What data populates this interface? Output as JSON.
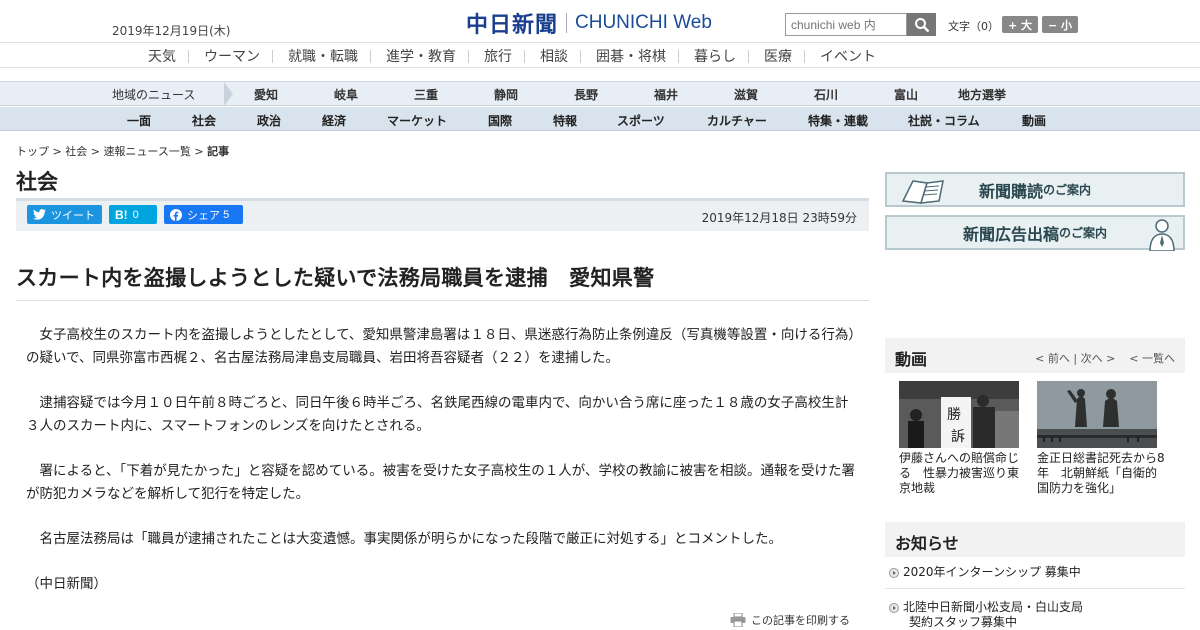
{
  "header": {
    "date": "2019年12月19日(木)",
    "logo_jp": "中日新聞",
    "logo_en": "CHUNICHI",
    "logo_web": "Web",
    "search_placeholder": "chunichi web 内",
    "font_label": "文字（0）",
    "font_up": "+ 大",
    "font_down": "− 小"
  },
  "nav_main": [
    "天気",
    "ウーマン",
    "就職・転職",
    "進学・教育",
    "旅行",
    "相談",
    "囲碁・将棋",
    "暮らし",
    "医療",
    "イベント"
  ],
  "nav_region": {
    "label": "地域のニュース",
    "items": [
      "愛知",
      "岐阜",
      "三重",
      "静岡",
      "長野",
      "福井",
      "滋賀",
      "石川",
      "富山",
      "地方選挙"
    ]
  },
  "nav_category": [
    "一面",
    "社会",
    "政治",
    "経済",
    "マーケット",
    "国際",
    "特報",
    "スポーツ",
    "カルチャー",
    "特集・連載",
    "社説・コラム",
    "動画"
  ],
  "breadcrumb": [
    "トップ",
    "社会",
    "速報ニュース一覧",
    "記事"
  ],
  "section_title": "社会",
  "share": {
    "tweet": "ツイート",
    "hatena": "B!",
    "hatena_count": "0",
    "facebook": "シェア",
    "facebook_count": "5"
  },
  "pubdate": "2019年12月18日 23時59分",
  "headline": "スカート内を盗撮しようとした疑いで法務局職員を逮捕　愛知県警",
  "paragraphs": [
    "　女子高校生のスカート内を盗撮しようとしたとして、愛知県警津島署は１８日、県迷惑行為防止条例違反（写真機等設置・向ける行為）の疑いで、同県弥富市西梶２、名古屋法務局津島支局職員、岩田将吾容疑者（２２）を逮捕した。",
    "　逮捕容疑では今月１０日午前８時ごろと、同日午後６時半ごろ、名鉄尾西線の電車内で、向かい合う席に座った１８歳の女子高校生計３人のスカート内に、スマートフォンのレンズを向けたとされる。",
    "　署によると、「下着が見たかった」と容疑を認めている。被害を受けた女子高校生の１人が、学校の教諭に被害を相談。通報を受けた署が防犯カメラなどを解析して犯行を特定した。",
    "　名古屋法務局は「職員が逮捕されたことは大変遺憾。事実関係が明らかになった段階で厳正に対処する」とコメントした。"
  ],
  "credit": "（中日新聞）",
  "print_label": "この記事を印刷する",
  "sidebar": {
    "banner1": {
      "big": "新聞購読",
      "small": "のご案内"
    },
    "banner2": {
      "big": "新聞広告出稿",
      "small": "のご案内"
    },
    "video": {
      "title": "動画",
      "prev": "前へ",
      "next": "次へ",
      "list": "一覧へ",
      "items": [
        {
          "caption": "伊藤さんへの賠償命じる　性暴力被害巡り東京地裁"
        },
        {
          "caption": "金正日総書記死去から8年　北朝鮮紙「自衛的国防力を強化」"
        }
      ]
    },
    "notice": {
      "title": "お知らせ",
      "items": [
        "2020年インターンシップ 募集中",
        "北陸中日新聞小松支局・白山支局",
        "契約スタッフ募集中"
      ]
    }
  },
  "colors": {
    "logo": "#1a3f8f",
    "twitter": "#1b95e0",
    "hatena": "#00a4de",
    "facebook": "#1877f2",
    "nav_region_bg": "#e8eef5",
    "nav_category_bg": "#d9e3ee"
  }
}
